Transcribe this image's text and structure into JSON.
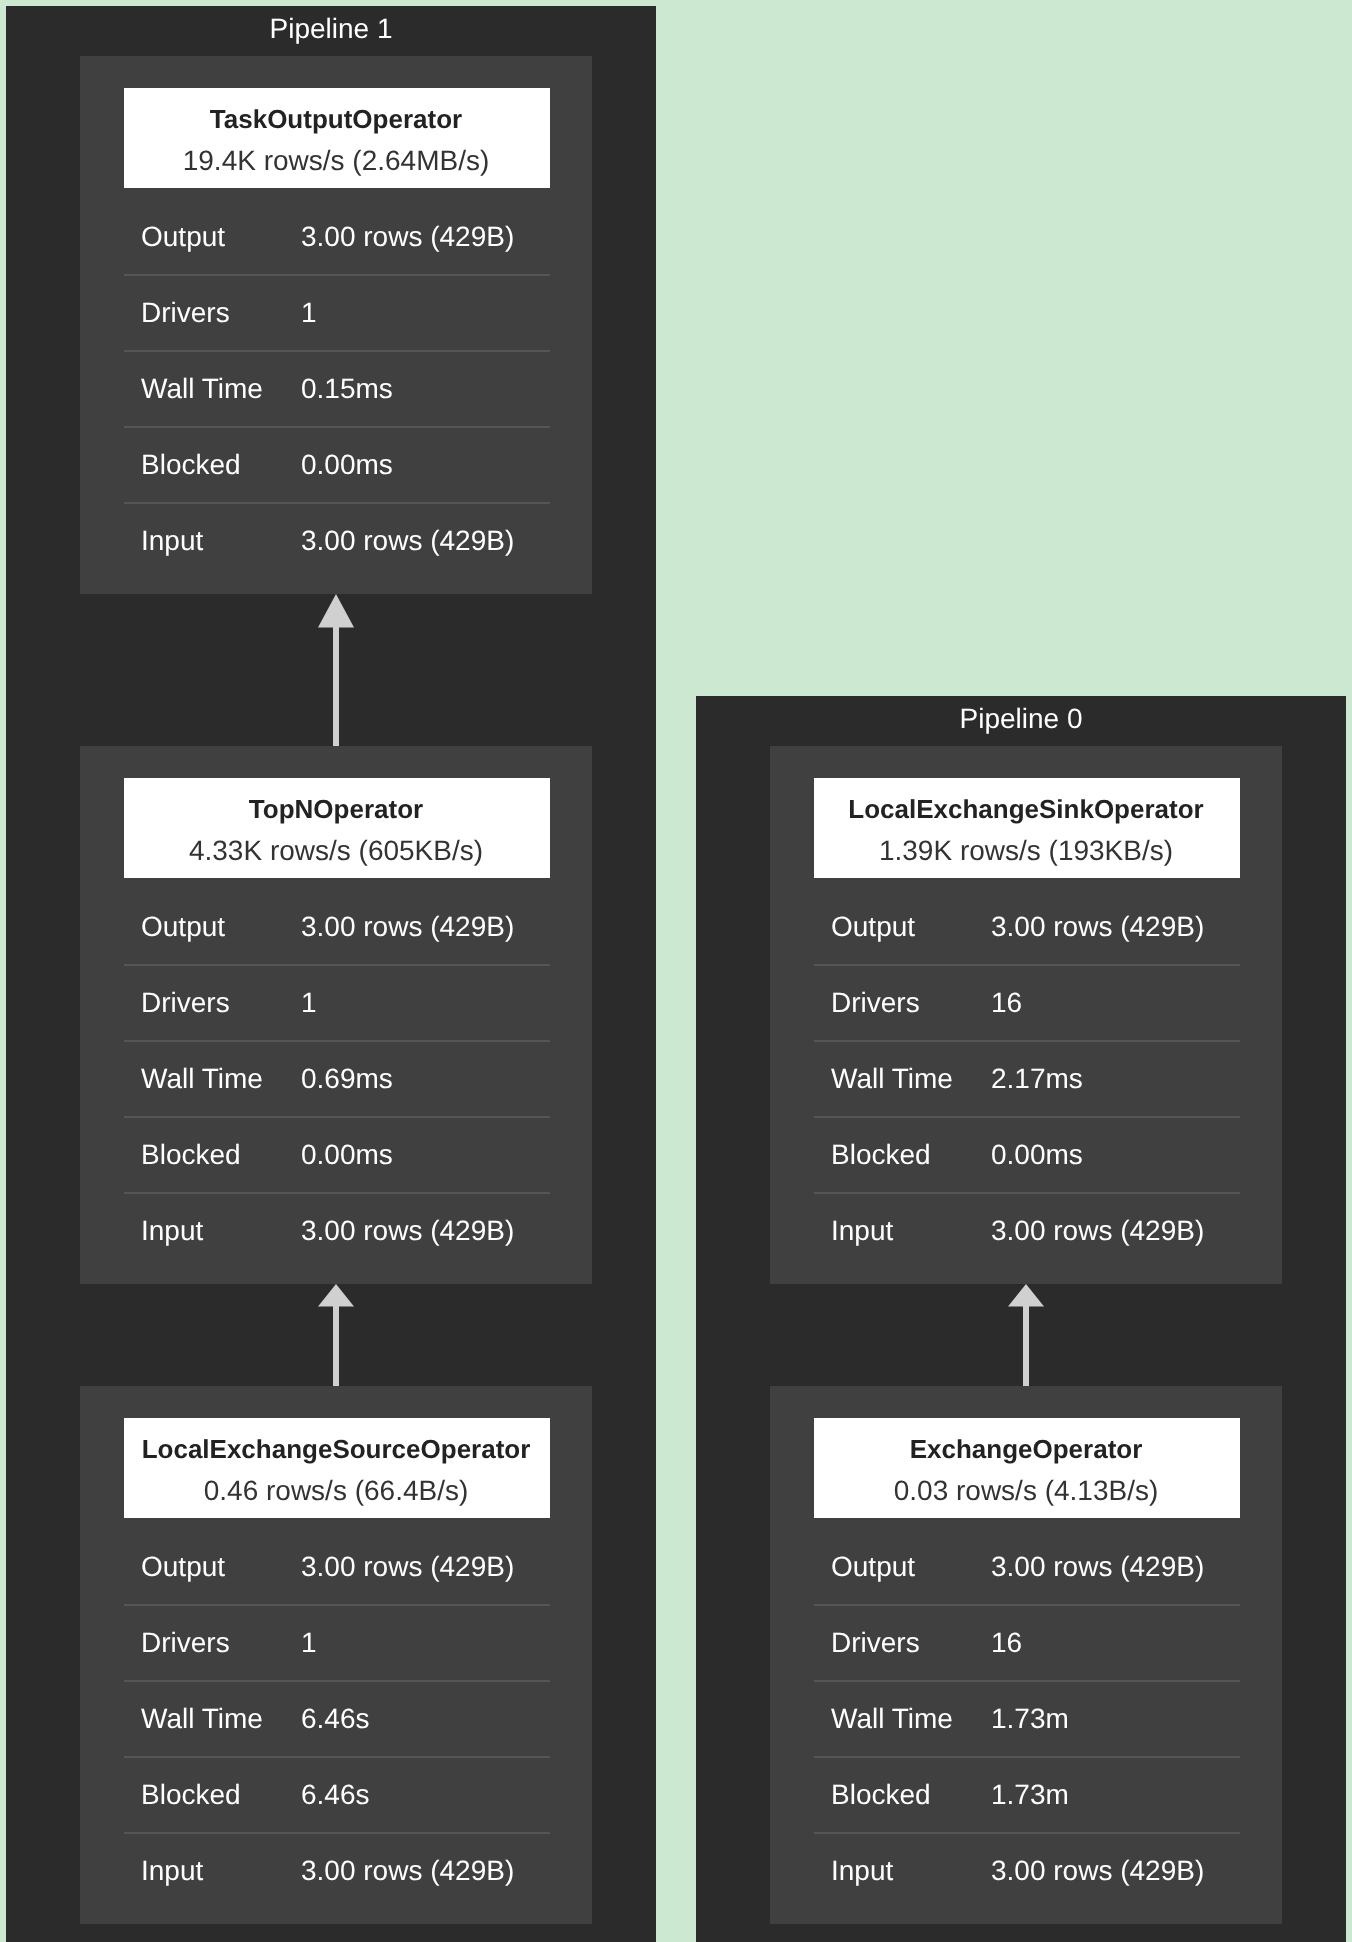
{
  "pipelines": [
    {
      "title": "Pipeline 1",
      "operators": [
        {
          "name": "TaskOutputOperator",
          "rate": "19.4K rows/s (2.64MB/s)",
          "stats": [
            {
              "label": "Output",
              "value": "3.00 rows (429B)"
            },
            {
              "label": "Drivers",
              "value": "1"
            },
            {
              "label": "Wall Time",
              "value": "0.15ms"
            },
            {
              "label": "Blocked",
              "value": "0.00ms"
            },
            {
              "label": "Input",
              "value": "3.00 rows (429B)"
            }
          ]
        },
        {
          "name": "TopNOperator",
          "rate": "4.33K rows/s (605KB/s)",
          "stats": [
            {
              "label": "Output",
              "value": "3.00 rows (429B)"
            },
            {
              "label": "Drivers",
              "value": "1"
            },
            {
              "label": "Wall Time",
              "value": "0.69ms"
            },
            {
              "label": "Blocked",
              "value": "0.00ms"
            },
            {
              "label": "Input",
              "value": "3.00 rows (429B)"
            }
          ]
        },
        {
          "name": "LocalExchangeSourceOperator",
          "rate": "0.46 rows/s (66.4B/s)",
          "stats": [
            {
              "label": "Output",
              "value": "3.00 rows (429B)"
            },
            {
              "label": "Drivers",
              "value": "1"
            },
            {
              "label": "Wall Time",
              "value": "6.46s"
            },
            {
              "label": "Blocked",
              "value": "6.46s"
            },
            {
              "label": "Input",
              "value": "3.00 rows (429B)"
            }
          ]
        }
      ]
    },
    {
      "title": "Pipeline 0",
      "operators": [
        {
          "name": "LocalExchangeSinkOperator",
          "rate": "1.39K rows/s (193KB/s)",
          "stats": [
            {
              "label": "Output",
              "value": "3.00 rows (429B)"
            },
            {
              "label": "Drivers",
              "value": "16"
            },
            {
              "label": "Wall Time",
              "value": "2.17ms"
            },
            {
              "label": "Blocked",
              "value": "0.00ms"
            },
            {
              "label": "Input",
              "value": "3.00 rows (429B)"
            }
          ]
        },
        {
          "name": "ExchangeOperator",
          "rate": "0.03 rows/s (4.13B/s)",
          "stats": [
            {
              "label": "Output",
              "value": "3.00 rows (429B)"
            },
            {
              "label": "Drivers",
              "value": "16"
            },
            {
              "label": "Wall Time",
              "value": "1.73m"
            },
            {
              "label": "Blocked",
              "value": "1.73m"
            },
            {
              "label": "Input",
              "value": "3.00 rows (429B)"
            }
          ]
        }
      ]
    }
  ]
}
